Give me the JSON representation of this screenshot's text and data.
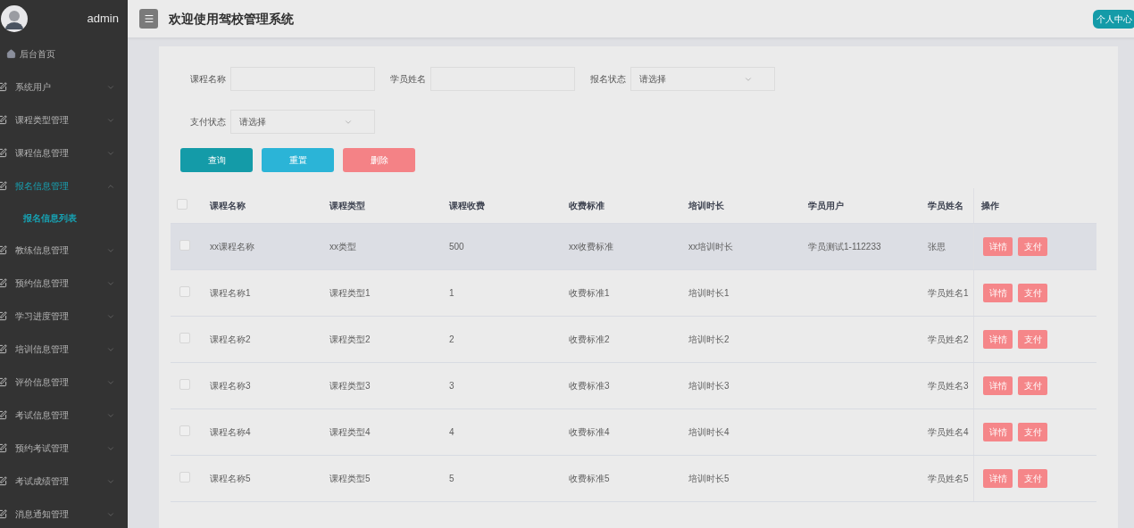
{
  "sidebar": {
    "user": "admin",
    "items": [
      {
        "label": "后台首页",
        "kind": "home"
      },
      {
        "label": "系统用户",
        "kind": "menu",
        "expanded": false
      },
      {
        "label": "课程类型管理",
        "kind": "menu",
        "expanded": false
      },
      {
        "label": "课程信息管理",
        "kind": "menu",
        "expanded": false
      },
      {
        "label": "报名信息管理",
        "kind": "menu",
        "expanded": true,
        "children": [
          {
            "label": "报名信息列表",
            "selected": true
          }
        ]
      },
      {
        "label": "教练信息管理",
        "kind": "menu",
        "expanded": false
      },
      {
        "label": "预约信息管理",
        "kind": "menu",
        "expanded": false
      },
      {
        "label": "学习进度管理",
        "kind": "menu",
        "expanded": false
      },
      {
        "label": "培训信息管理",
        "kind": "menu",
        "expanded": false
      },
      {
        "label": "评价信息管理",
        "kind": "menu",
        "expanded": false
      },
      {
        "label": "考试信息管理",
        "kind": "menu",
        "expanded": false
      },
      {
        "label": "预约考试管理",
        "kind": "menu",
        "expanded": false
      },
      {
        "label": "考试成绩管理",
        "kind": "menu",
        "expanded": false
      },
      {
        "label": "消息通知管理",
        "kind": "menu",
        "expanded": false
      }
    ]
  },
  "header": {
    "title": "欢迎使用驾校管理系统",
    "profile_button": "个人中心"
  },
  "filters": [
    {
      "label": "课程名称",
      "kind": "text"
    },
    {
      "label": "学员姓名",
      "kind": "text"
    },
    {
      "label": "报名状态",
      "kind": "select",
      "value": "请选择"
    },
    {
      "label": "支付状态",
      "kind": "select",
      "value": "请选择"
    }
  ],
  "buttons": [
    {
      "label": "查询",
      "kind": "query"
    },
    {
      "label": "重置",
      "kind": "reset"
    },
    {
      "label": "删除",
      "kind": "delete"
    }
  ],
  "table": {
    "select_all": {
      "checked": false
    },
    "columns": [
      "课程名称",
      "课程类型",
      "课程收费",
      "收费标准",
      "培训时长",
      "学员用户",
      "学员姓名",
      "操作"
    ],
    "rows": [
      {
        "checked": false,
        "hovered": true,
        "cells": [
          "xx课程名称",
          "xx类型",
          "500",
          "xx收费标准",
          "xx培训时长",
          "学员测试1-112233",
          "张思"
        ],
        "actions": [
          "详情",
          "支付"
        ]
      },
      {
        "checked": false,
        "hovered": false,
        "cells": [
          "课程名称1",
          "课程类型1",
          "1",
          "收费标准1",
          "培训时长1",
          "",
          "学员姓名1"
        ],
        "actions": [
          "详情",
          "支付"
        ]
      },
      {
        "checked": false,
        "hovered": false,
        "cells": [
          "课程名称2",
          "课程类型2",
          "2",
          "收费标准2",
          "培训时长2",
          "",
          "学员姓名2"
        ],
        "actions": [
          "详情",
          "支付"
        ]
      },
      {
        "checked": false,
        "hovered": false,
        "cells": [
          "课程名称3",
          "课程类型3",
          "3",
          "收费标准3",
          "培训时长3",
          "",
          "学员姓名3"
        ],
        "actions": [
          "详情",
          "支付"
        ]
      },
      {
        "checked": false,
        "hovered": false,
        "cells": [
          "课程名称4",
          "课程类型4",
          "4",
          "收费标准4",
          "培训时长4",
          "",
          "学员姓名4"
        ],
        "actions": [
          "详情",
          "支付"
        ]
      },
      {
        "checked": false,
        "hovered": false,
        "cells": [
          "课程名称5",
          "课程类型5",
          "5",
          "收费标准5",
          "培训时长5",
          "",
          "学员姓名5"
        ],
        "actions": [
          "详情",
          "支付"
        ]
      }
    ]
  }
}
